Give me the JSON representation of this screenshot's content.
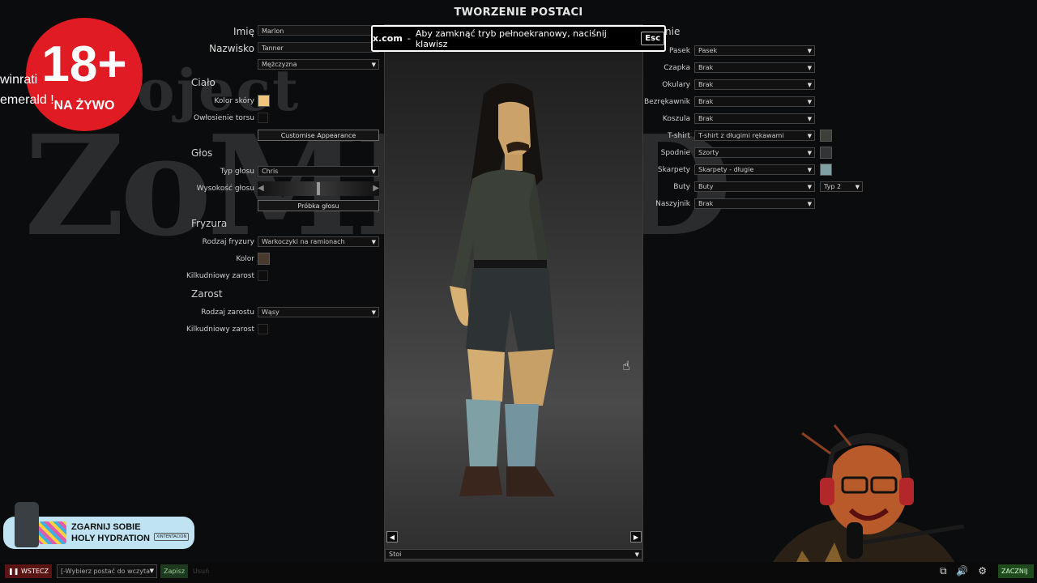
{
  "screen_title": "TWORZENIE POSTACI",
  "background_logo": {
    "line1": "roject",
    "line2": "ZoMBoID"
  },
  "toast": {
    "site": "x.com",
    "separator": "-",
    "message": "Aby zamknąć tryb pełnoekranowy, naciśnij klawisz",
    "key": "Esc"
  },
  "left_panel": {
    "first_name_label": "Imię",
    "first_name_value": "Marlon",
    "last_name_label": "Nazwisko",
    "last_name_value": "Tanner",
    "gender_value": "Mężczyzna",
    "body_section": "Ciało",
    "skin_color_label": "Kolor skóry",
    "body_hair_label": "Owłosienie torsu",
    "customise_button": "Customise Appearance",
    "voice_section": "Głos",
    "voice_type_label": "Typ głosu",
    "voice_type_value": "Chris",
    "voice_pitch_label": "Wysokość głosu",
    "voice_sample_button": "Próbka głosu",
    "hair_section": "Fryzura",
    "hair_type_label": "Rodzaj fryzury",
    "hair_type_value": "Warkoczyki na ramionach",
    "hair_color_label": "Kolor",
    "stubble_label": "Kilkudniowy zarost",
    "beard_section": "Zarost",
    "beard_type_label": "Rodzaj zarostu",
    "beard_type_value": "Wąsy",
    "beard_stubble_label": "Kilkudniowy zarost"
  },
  "clothing_panel": {
    "header_fragment": "nie",
    "rows": [
      {
        "label": "Pasek",
        "value": "Pasek"
      },
      {
        "label": "Czapka",
        "value": "Brak"
      },
      {
        "label": "Okulary",
        "value": "Brak"
      },
      {
        "label": "Bezrękawnik",
        "value": "Brak"
      },
      {
        "label": "Koszula",
        "value": "Brak"
      },
      {
        "label": "T-shirt",
        "value": "T-shirt z długimi rękawami"
      },
      {
        "label": "Spodnie",
        "value": "Szorty"
      },
      {
        "label": "Skarpety",
        "value": "Skarpety - długie"
      },
      {
        "label": "Buty",
        "value": "Buty"
      },
      {
        "label": "Naszyjnik",
        "value": "Brak"
      }
    ],
    "shoe_variant": "Typ 2"
  },
  "preview": {
    "left_arrow": "◀",
    "right_arrow": "▶",
    "pose_value": "Stoi"
  },
  "overlay": {
    "badge_number": "18+",
    "badge_sub": "NA ŻYWO",
    "side_text_1": "winrati",
    "side_text_2": "emerald !",
    "promo_line1": "ZGARNIJ SOBIE",
    "promo_line2": "HOLY HYDRATION",
    "promo_tag": "XINTENTACION"
  },
  "bottom_bar": {
    "back_button": "WSTECZ",
    "load_select": "[-Wybierz postać do wczyta",
    "save_button": "Zapisz",
    "delete_button": "Usuń",
    "right_button": "ZACZNIJ"
  },
  "colors": {
    "skin": "#f0c77a",
    "hair": "#4a3a2a",
    "tshirt": "#3b4138",
    "shorts": "#313536",
    "socks": "#7fa0a4",
    "badge_red": "#e01b24",
    "promo_bg": "#bfe3f2"
  }
}
